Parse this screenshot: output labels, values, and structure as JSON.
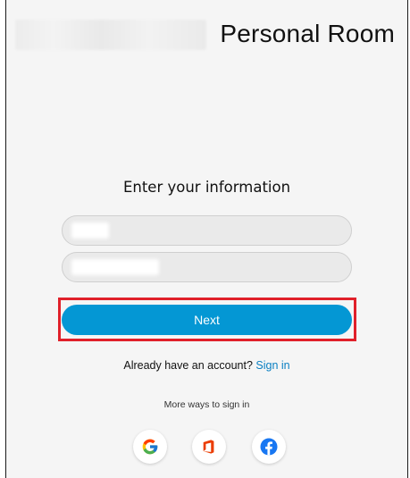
{
  "header": {
    "title": "Personal Room"
  },
  "form": {
    "heading": "Enter your information",
    "field1": {
      "value": "",
      "placeholder": ""
    },
    "field2": {
      "value": "",
      "placeholder": ""
    },
    "next_label": "Next"
  },
  "signin": {
    "prompt": "Already have an account?",
    "link": "Sign in"
  },
  "more_ways": {
    "label": "More ways to sign in",
    "providers": [
      {
        "name": "google-icon",
        "color": "#4285F4"
      },
      {
        "name": "office-icon",
        "color": "#EB3C00"
      },
      {
        "name": "facebook-icon",
        "color": "#1877F2"
      }
    ]
  },
  "colors": {
    "accent": "#0497d4",
    "link": "#0a7fc2",
    "highlight": "#e0202a"
  }
}
